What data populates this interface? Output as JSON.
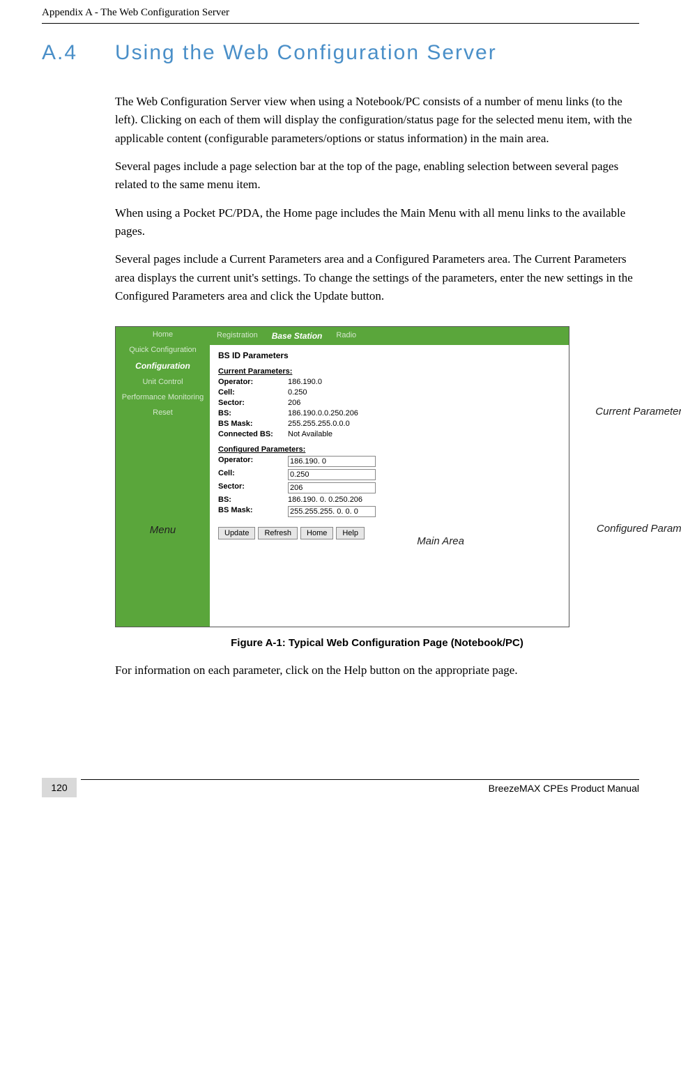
{
  "header": {
    "appendix": "Appendix A - The Web Configuration Server"
  },
  "section": {
    "number": "A.4",
    "title": "Using the Web Configuration Server"
  },
  "paragraphs": {
    "p1": "The Web Configuration Server view when using a Notebook/PC consists of a number of menu links (to the left). Clicking on each of them will display the configuration/status page for the selected menu item, with the applicable content (configurable parameters/options or status information) in the main area.",
    "p2": "Several pages include a page selection bar at the top of the page, enabling selection between several pages related to the same menu item.",
    "p3": "When using a Pocket PC/PDA, the Home page includes the Main Menu with all menu links to the available pages.",
    "p4": "Several pages include a Current Parameters area and a Configured Parameters area. The Current Parameters area displays the current unit's settings. To change the settings of the parameters, enter the new settings in the Configured Parameters area and click the Update button.",
    "p5": "For information on each parameter, click on the Help button on the appropriate page."
  },
  "figure": {
    "caption": "Figure A-1: Typical Web Configuration Page (Notebook/PC)",
    "sidebar": {
      "items": [
        "Home",
        "Quick Configuration",
        "Configuration",
        "Unit Control",
        "Performance Monitoring",
        "Reset"
      ],
      "menu_label": "Menu"
    },
    "tabs": {
      "items": [
        "Registration",
        "Base Station",
        "Radio"
      ]
    },
    "panel_title": "BS ID Parameters",
    "current_heading": "Current Parameters:",
    "configured_heading": "Configured Parameters:",
    "current": {
      "operator_label": "Operator:",
      "operator_value": "186.190.0",
      "cell_label": "Cell:",
      "cell_value": "0.250",
      "sector_label": "Sector:",
      "sector_value": "206",
      "bs_label": "BS:",
      "bs_value": "186.190.0.0.250.206",
      "bsmask_label": "BS Mask:",
      "bsmask_value": "255.255.255.0.0.0",
      "connected_label": "Connected BS:",
      "connected_value": "Not Available"
    },
    "configured": {
      "operator_label": "Operator:",
      "operator_value": "186.190. 0",
      "cell_label": "Cell:",
      "cell_value": "0.250",
      "sector_label": "Sector:",
      "sector_value": "206",
      "bs_label": "BS:",
      "bs_value": "186.190. 0. 0.250.206",
      "bsmask_label": "BS Mask:",
      "bsmask_value": "255.255.255. 0. 0. 0"
    },
    "buttons": {
      "update": "Update",
      "refresh": "Refresh",
      "home": "Home",
      "help": "Help"
    },
    "annotations": {
      "current": "Current Parameters",
      "configured": "Configured Parameters",
      "main": "Main Area"
    }
  },
  "footer": {
    "page": "120",
    "manual": "BreezeMAX CPEs Product Manual"
  }
}
